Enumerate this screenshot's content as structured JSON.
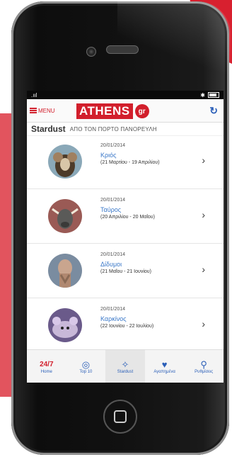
{
  "status": {
    "signal": ".ııl",
    "bluetooth": "✱"
  },
  "nav": {
    "menu_label": "MENU",
    "logo_text": "ATHENS",
    "logo_suffix": "gr"
  },
  "page": {
    "title": "Stardust",
    "subtitle": "ΑΠΟ ΤΟΝ ΠΟΡΤΟ ΠΑΝΟΡΕΥΛΗ"
  },
  "items": [
    {
      "date": "20/01/2014",
      "sign": "Κριός",
      "range": "(21 Μαρτίου - 19 Απριλίου)"
    },
    {
      "date": "20/01/2014",
      "sign": "Ταύρος",
      "range": "(20 Απριλίου - 20 Μαΐου)"
    },
    {
      "date": "20/01/2014",
      "sign": "Δίδυμοι",
      "range": "(21 Μαΐου - 21 Ιουνίου)"
    },
    {
      "date": "20/01/2014",
      "sign": "Καρκίνος",
      "range": "(22 Ιουνίου - 22 Ιουλίου)"
    }
  ],
  "tabs": [
    {
      "label": "Home",
      "icon": "24/7"
    },
    {
      "label": "Top 10",
      "icon": "◎"
    },
    {
      "label": "Stardust",
      "icon": "✧"
    },
    {
      "label": "Αγαπημένα",
      "icon": "♥"
    },
    {
      "label": "Ρυθμίσεις",
      "icon": "⚲"
    }
  ],
  "colors": {
    "brand_red": "#d21f2c",
    "link_blue": "#3a78c8",
    "tab_blue": "#2b5fb8"
  }
}
